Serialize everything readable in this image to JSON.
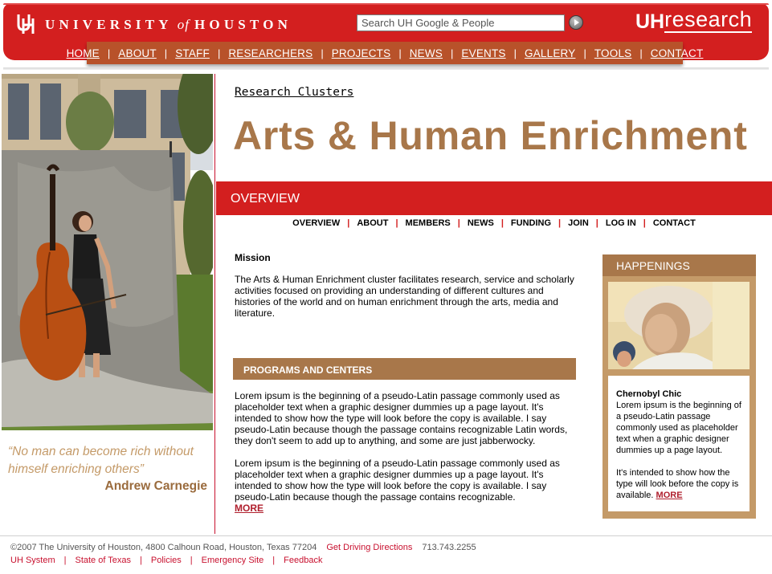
{
  "header": {
    "wordmark_left": "UNIVERSITY",
    "wordmark_of": "of",
    "wordmark_right": "HOUSTON",
    "search_placeholder": "Search UH Google & People",
    "brand_uh": "UH",
    "brand_research": "research",
    "nav": [
      "HOME",
      "ABOUT",
      "STAFF",
      "RESEARCHERS",
      "PROJECTS",
      "NEWS",
      "EVENTS",
      "GALLERY",
      "TOOLS",
      "CONTACT"
    ]
  },
  "sidebar": {
    "quote": "“No man can become rich without himself enriching others”",
    "quote_author": "Andrew Carnegie"
  },
  "main": {
    "section_label": "Research Clusters",
    "title": "Arts & Human Enrichment",
    "overview_label": "OVERVIEW",
    "subnav": [
      "OVERVIEW",
      "ABOUT",
      "MEMBERS",
      "NEWS",
      "FUNDING",
      "JOIN",
      "LOG IN",
      "CONTACT"
    ],
    "mission_heading": "Mission",
    "mission_text": "The Arts & Human Enrichment cluster facilitates research, service and scholarly activities focused on providing an understanding of different cultures and histories of the world and on human enrichment through the arts, media and literature.",
    "programs_heading": "PROGRAMS AND CENTERS",
    "programs_text_1": "Lorem ipsum is the beginning of a pseudo-Latin passage commonly used as placeholder text when a graphic designer dummies up a page layout. It's intended to show how the type will look before the copy is available. I say pseudo-Latin because though the passage contains recognizable Latin words, they don't seem to add up to anything, and some are just jabberwocky.",
    "programs_text_2": "Lorem ipsum is the beginning of a pseudo-Latin passage commonly used as placeholder text when a graphic designer dummies up a page layout. It's intended to show how the type will look before the copy is available. I say pseudo-Latin because though the passage contains recognizable.",
    "more_label": "MORE"
  },
  "happenings": {
    "title": "HAPPENINGS",
    "event_title": "Chernobyl Chic",
    "event_text": "Lorem ipsum is the beginning of a pseudo-Latin passage commonly used as placeholder text when a graphic designer dummies up a page layout.",
    "event_text_2": "It's intended to show how the type will look before the copy is available.",
    "more_label": "MORE"
  },
  "footer": {
    "copyright": "©2007 The University of Houston, 4800 Calhoun Road, Houston, Texas 77204",
    "directions": "Get Driving Directions",
    "phone": "713.743.2255",
    "links": [
      "UH System",
      "State of Texas",
      "Policies",
      "Emergency Site",
      "Feedback"
    ]
  },
  "colors": {
    "uh_red": "#d31f1f",
    "nav_brown": "#b8522a",
    "tan": "#a8774a",
    "light_tan": "#c49a68",
    "link_red": "#c8102e"
  }
}
